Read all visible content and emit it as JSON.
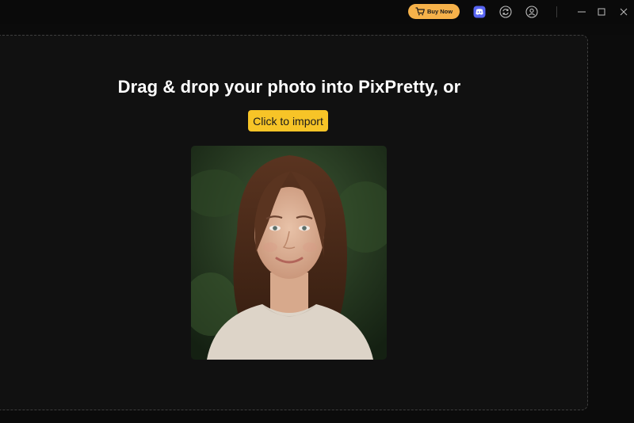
{
  "titlebar": {
    "buy_label": "Buy Now",
    "icons": [
      "cart-icon",
      "discord-icon",
      "sync-icon",
      "user-icon",
      "minimize-icon",
      "maximize-icon",
      "close-icon"
    ]
  },
  "dropzone": {
    "headline": "Drag & drop your photo into PixPretty, or",
    "import_label": "Click to import"
  },
  "colors": {
    "background": "#0b0b0b",
    "dropzone_bg": "#111111",
    "buy_button": "#f6b24a",
    "import_button": "#f7c427",
    "discord_blue": "#5865f2"
  }
}
